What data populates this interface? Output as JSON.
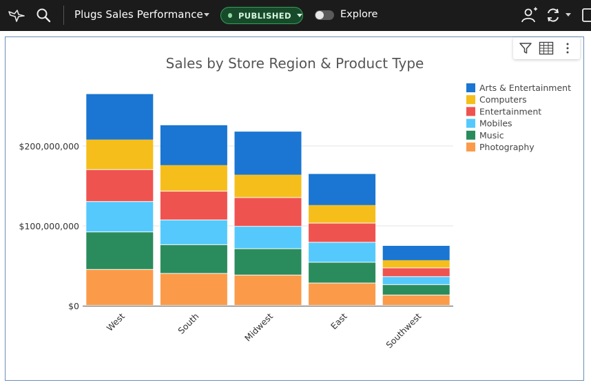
{
  "header": {
    "title": "Plugs Sales Performance",
    "status": "PUBLISHED",
    "explore_label": "Explore",
    "icons": [
      "hummingbird-logo-icon",
      "search-icon",
      "share-user-icon",
      "refresh-icon",
      "more-icon"
    ]
  },
  "toolbar": {
    "icons": [
      "filter-icon",
      "table-icon",
      "more-vertical-icon"
    ]
  },
  "colors": {
    "accent_green": "#36a05a",
    "panel_border": "#6a8cb4"
  },
  "chart_data": {
    "type": "bar",
    "stacked": true,
    "title": "Sales by Store Region & Product Type",
    "xlabel": "",
    "ylabel": "",
    "categories": [
      "West",
      "South",
      "Midwest",
      "East",
      "Southwest"
    ],
    "ylim": [
      0,
      280000000
    ],
    "yticks": [
      {
        "value": 0,
        "label": "$0"
      },
      {
        "value": 100000000,
        "label": "$100,000,000"
      },
      {
        "value": 200000000,
        "label": "$200,000,000"
      }
    ],
    "grid": true,
    "legend_position": "right",
    "series": [
      {
        "name": "Photography",
        "color": "#fb9b4a",
        "values": [
          45000000,
          40000000,
          38000000,
          28000000,
          13000000
        ]
      },
      {
        "name": "Music",
        "color": "#2a8c5c",
        "values": [
          47000000,
          36000000,
          33000000,
          26000000,
          13000000
        ]
      },
      {
        "name": "Mobiles",
        "color": "#55c9fc",
        "values": [
          38000000,
          31000000,
          28000000,
          25000000,
          10000000
        ]
      },
      {
        "name": "Entertainment",
        "color": "#ef5350",
        "values": [
          40000000,
          36000000,
          36000000,
          24000000,
          11000000
        ]
      },
      {
        "name": "Computers",
        "color": "#f5be1a",
        "values": [
          38000000,
          33000000,
          29000000,
          23000000,
          10000000
        ]
      },
      {
        "name": "Arts & Entertainment",
        "color": "#1a76d2",
        "values": [
          57000000,
          50000000,
          54000000,
          39000000,
          18000000
        ]
      }
    ]
  }
}
